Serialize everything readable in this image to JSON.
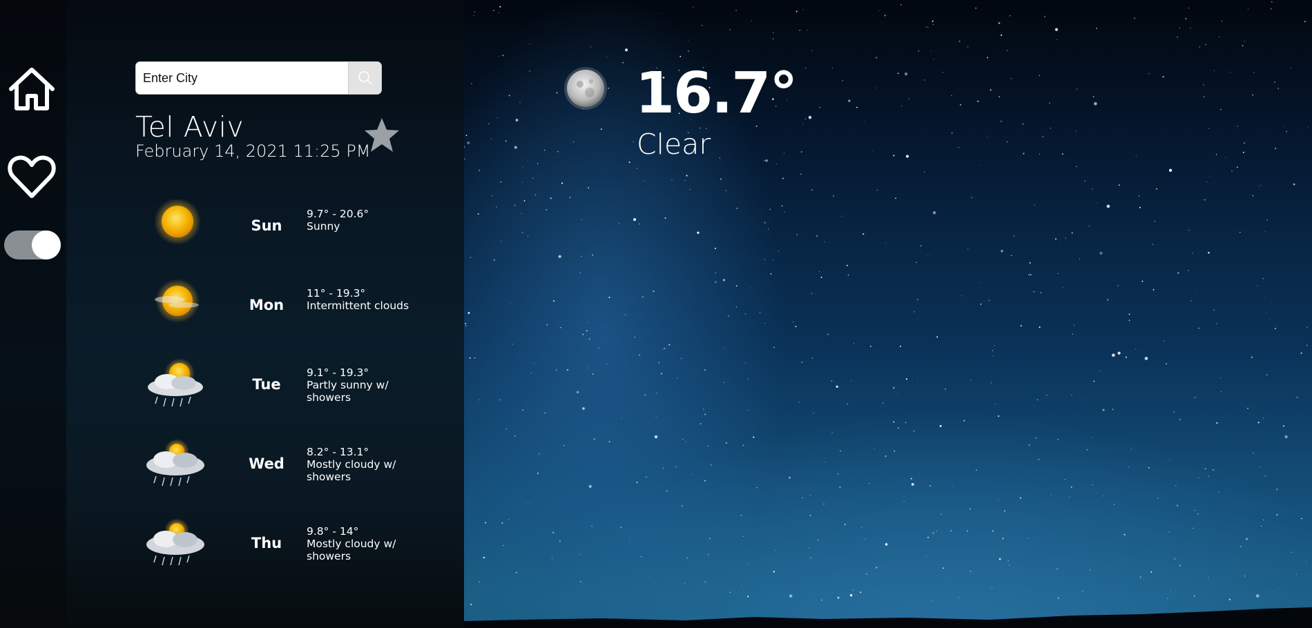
{
  "search": {
    "placeholder": "Enter City"
  },
  "location": {
    "city": "Tel Aviv",
    "datetime": "February 14, 2021 11:25 PM"
  },
  "current": {
    "temperature": "16.7°",
    "condition": "Clear",
    "icon": "moon-icon"
  },
  "nav": {
    "items": [
      "home-icon",
      "heart-icon"
    ],
    "theme_toggle_on": true
  },
  "forecast": [
    {
      "day": "Sun",
      "range": "9.7° - 20.6°",
      "condition": "Sunny",
      "icon": "sun-icon"
    },
    {
      "day": "Mon",
      "range": "11° - 19.3°",
      "condition": "Intermittent clouds",
      "icon": "hazy-sun-icon"
    },
    {
      "day": "Tue",
      "range": "9.1° - 19.3°",
      "condition": "Partly sunny w/ showers",
      "icon": "sun-cloud-rain-icon"
    },
    {
      "day": "Wed",
      "range": "8.2° - 13.1°",
      "condition": "Mostly cloudy w/ showers",
      "icon": "cloud-rain-icon"
    },
    {
      "day": "Thu",
      "range": "9.8° - 14°",
      "condition": "Mostly cloudy w/ showers",
      "icon": "cloud-rain-icon"
    }
  ],
  "colors": {
    "sky_top": "#02070f",
    "sky_bottom": "#1b5f86",
    "panel": "#081622",
    "star": "#9aa0a6",
    "sun": "#f5b400"
  }
}
